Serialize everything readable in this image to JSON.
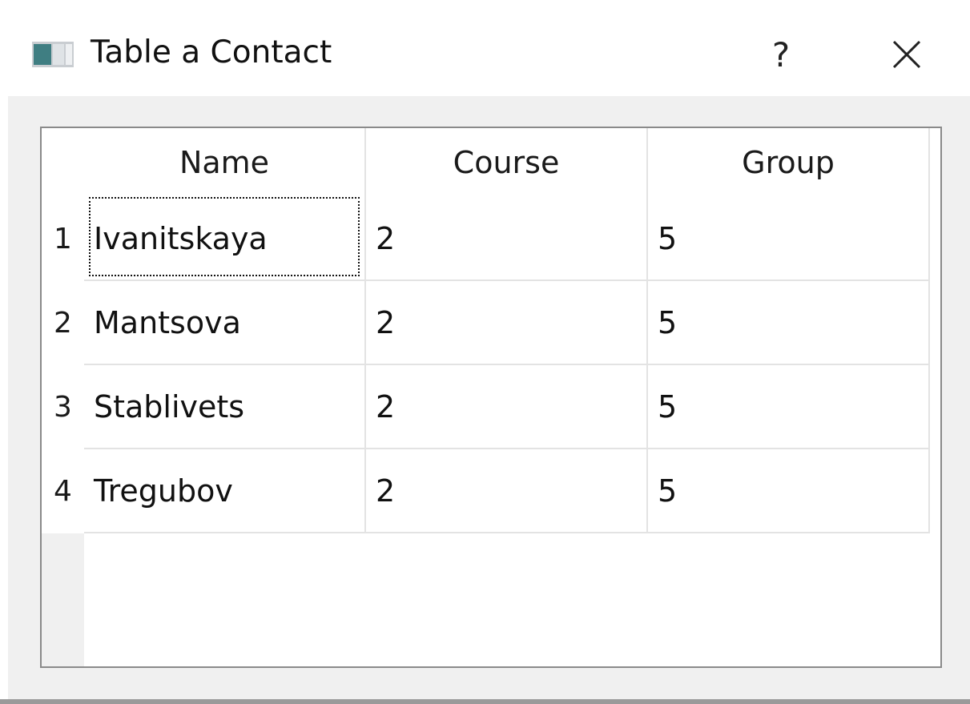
{
  "window": {
    "title": "Table a Contact",
    "help_label": "?"
  },
  "table": {
    "columns": [
      "Name",
      "Course",
      "Group"
    ],
    "rows": [
      {
        "number": "1",
        "cells": [
          "Ivanitskaya",
          "2",
          "5"
        ]
      },
      {
        "number": "2",
        "cells": [
          "Mantsova",
          "2",
          "5"
        ]
      },
      {
        "number": "3",
        "cells": [
          "Stablivets",
          "2",
          "5"
        ]
      },
      {
        "number": "4",
        "cells": [
          "Tregubov",
          "2",
          "5"
        ]
      }
    ],
    "focused_cell": "row 1, Name"
  },
  "colors": {
    "client_background": "#f0f0f0",
    "grid_line": "#e3e3e3",
    "frame_border": "#8a8a8a"
  }
}
